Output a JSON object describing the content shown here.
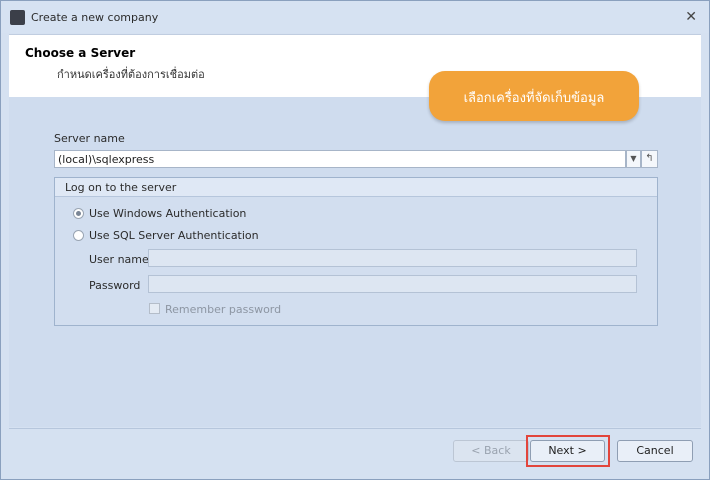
{
  "window": {
    "title": "Create a new company"
  },
  "header": {
    "title": "Choose a Server",
    "subtitle": "กำหนดเครื่องที่ต้องการเชื่อมต่อ"
  },
  "callout": {
    "text": "เลือกเครื่องที่จัดเก็บข้อมูล"
  },
  "server": {
    "label": "Server name",
    "value": "(local)\\sqlexpress"
  },
  "logon": {
    "title": "Log on to the server",
    "windows_auth": "Use Windows Authentication",
    "sql_auth": "Use SQL Server Authentication",
    "username_label": "User name",
    "password_label": "Password",
    "remember": "Remember password",
    "selected": "windows"
  },
  "buttons": {
    "back": "< Back",
    "next": "Next >",
    "cancel": "Cancel"
  },
  "colors": {
    "callout": "#f2a33a",
    "highlight": "#e2453c"
  }
}
